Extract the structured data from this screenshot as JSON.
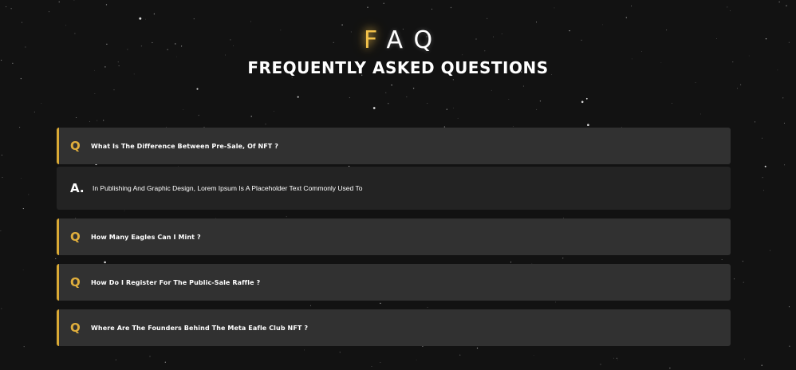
{
  "header": {
    "faq_letter_1": "F",
    "faq_letters_rest": "AQ",
    "title": "FREQUENTLY ASKED QUESTIONS"
  },
  "faq": {
    "question_marker": "Q",
    "answer_marker": "A.",
    "items": [
      {
        "question": "What Is The Difference Between Pre-Sale, Of NFT ?",
        "expanded": true,
        "answer": "In Publishing And Graphic Design, Lorem Ipsum Is A Placeholder Text Commonly Used To"
      },
      {
        "question": "How Many Eagles Can I Mint ?",
        "expanded": false
      },
      {
        "question": "How Do I Register For The Public-Sale Raffle ?",
        "expanded": false
      },
      {
        "question": "Where Are The Founders Behind The Meta Eafle Club NFT ?",
        "expanded": false
      }
    ]
  },
  "colors": {
    "background": "#121212",
    "accent": "#d9a935",
    "card": "#313131",
    "answer_card": "#232323"
  }
}
